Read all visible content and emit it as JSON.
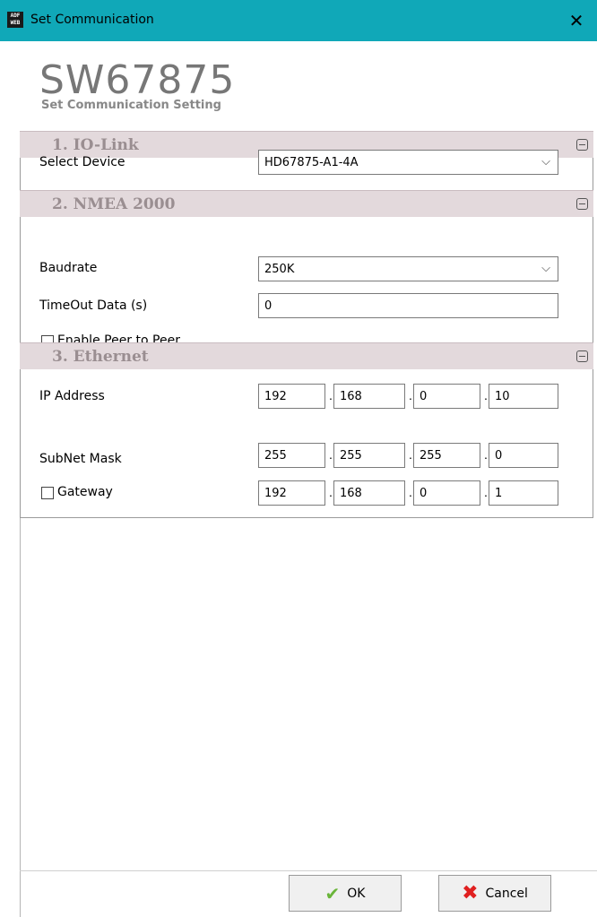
{
  "window": {
    "title": "Set Communication",
    "icon_text": "ADF\nWEB"
  },
  "header": {
    "code": "SW67875",
    "subtitle": "Set Communication Setting"
  },
  "sections": {
    "iolink": {
      "title": "1. IO-Link",
      "select_device_label": "Select Device",
      "select_device_value": "HD67875-A1-4A"
    },
    "nmea": {
      "title": "2. NMEA 2000",
      "baudrate_label": "Baudrate",
      "baudrate_value": "250K",
      "timeout_label": "TimeOut Data (s)",
      "timeout_value": "0",
      "peer_label": "Enable Peer to Peer",
      "peer_checked": false
    },
    "ethernet": {
      "title": "3. Ethernet",
      "ip_label": "IP Address",
      "ip": [
        "192",
        "168",
        "0",
        "10"
      ],
      "mask_label": "SubNet Mask",
      "mask": [
        "255",
        "255",
        "255",
        "0"
      ],
      "gateway_label": "Gateway",
      "gateway_checked": false,
      "gateway": [
        "192",
        "168",
        "0",
        "1"
      ]
    }
  },
  "buttons": {
    "ok": "OK",
    "cancel": "Cancel"
  },
  "icons": {
    "collapse": "collapse-icon",
    "ok": "check-icon",
    "cancel": "x-icon",
    "close": "close-icon"
  },
  "colors": {
    "titlebar": "#10a8b8",
    "section": "#e3d9dc"
  }
}
